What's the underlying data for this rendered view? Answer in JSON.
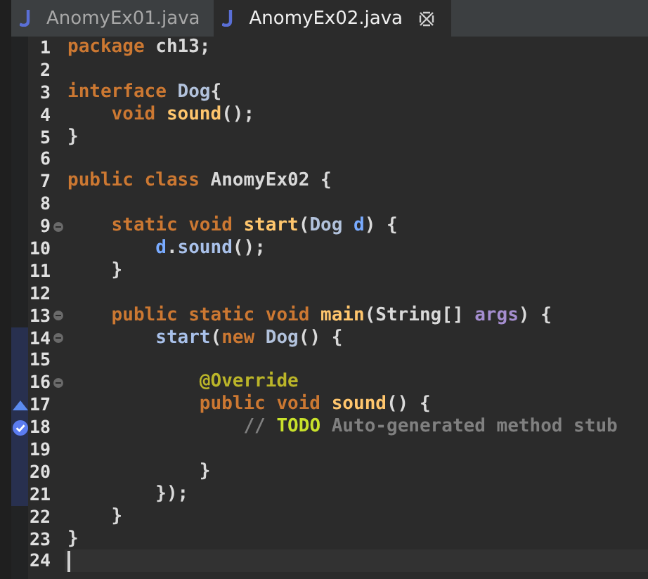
{
  "tabs": [
    {
      "label": "AnomyEx01.java",
      "selected": false
    },
    {
      "label": "AnomyEx02.java",
      "selected": true
    }
  ],
  "lines": [
    {
      "number": "1",
      "kind": "code",
      "fold": false,
      "range": false,
      "current": false,
      "tokens": [
        {
          "kind": "keyword",
          "text": "package "
        },
        {
          "kind": "plain",
          "text": "ch13;"
        }
      ]
    },
    {
      "number": "2",
      "kind": "code",
      "fold": false,
      "range": false,
      "current": false
    },
    {
      "number": "3",
      "kind": "code",
      "fold": false,
      "range": false,
      "current": false,
      "tokens": [
        {
          "kind": "keyword",
          "text": "interface "
        },
        {
          "kind": "type",
          "text": "Dog"
        },
        {
          "kind": "plain",
          "text": "{"
        }
      ]
    },
    {
      "number": "4",
      "kind": "code",
      "fold": false,
      "range": false,
      "current": false,
      "tokens": [
        {
          "kind": "keyword",
          "text": "    void "
        },
        {
          "kind": "decl",
          "text": "sound"
        },
        {
          "kind": "plain",
          "text": "();"
        }
      ]
    },
    {
      "number": "5",
      "kind": "code",
      "fold": false,
      "range": false,
      "current": false,
      "tokens": [
        {
          "kind": "plain",
          "text": "}"
        }
      ]
    },
    {
      "number": "6",
      "kind": "code",
      "fold": false,
      "range": false,
      "current": false
    },
    {
      "number": "7",
      "kind": "code",
      "fold": false,
      "range": false,
      "current": false,
      "tokens": [
        {
          "kind": "keyword",
          "text": "public class "
        },
        {
          "kind": "plain",
          "text": "AnomyEx02 {"
        }
      ]
    },
    {
      "number": "8",
      "kind": "code",
      "fold": false,
      "range": false,
      "current": false
    },
    {
      "number": "9",
      "kind": "code",
      "fold": true,
      "range": false,
      "current": false,
      "tokens": [
        {
          "kind": "keyword",
          "text": "    static void "
        },
        {
          "kind": "decl",
          "text": "start"
        },
        {
          "kind": "plain",
          "text": "("
        },
        {
          "kind": "type",
          "text": "Dog "
        },
        {
          "kind": "param",
          "text": "d"
        },
        {
          "kind": "plain",
          "text": ") {"
        }
      ]
    },
    {
      "number": "10",
      "kind": "code",
      "fold": false,
      "range": false,
      "current": false,
      "tokens": [
        {
          "kind": "param",
          "text": "        d"
        },
        {
          "kind": "plain",
          "text": "."
        },
        {
          "kind": "call",
          "text": "sound"
        },
        {
          "kind": "plain",
          "text": "();"
        }
      ]
    },
    {
      "number": "11",
      "kind": "code",
      "fold": false,
      "range": false,
      "current": false,
      "tokens": [
        {
          "kind": "plain",
          "text": "    }"
        }
      ]
    },
    {
      "number": "12",
      "kind": "code",
      "fold": false,
      "range": false,
      "current": false
    },
    {
      "number": "13",
      "kind": "code",
      "fold": true,
      "range": false,
      "current": false,
      "tokens": [
        {
          "kind": "keyword",
          "text": "    public static void "
        },
        {
          "kind": "decl",
          "text": "main"
        },
        {
          "kind": "plain",
          "text": "(String[] "
        },
        {
          "kind": "args",
          "text": "args"
        },
        {
          "kind": "plain",
          "text": ") {"
        }
      ]
    },
    {
      "number": "14",
      "kind": "code",
      "fold": true,
      "range": true,
      "current": false,
      "tokens": [
        {
          "kind": "call",
          "text": "        start"
        },
        {
          "kind": "plain",
          "text": "("
        },
        {
          "kind": "keyword",
          "text": "new "
        },
        {
          "kind": "type",
          "text": "Dog"
        },
        {
          "kind": "plain",
          "text": "() {"
        }
      ]
    },
    {
      "number": "15",
      "kind": "code",
      "fold": false,
      "range": true,
      "current": false
    },
    {
      "number": "16",
      "kind": "code",
      "fold": true,
      "range": true,
      "current": false,
      "tokens": [
        {
          "kind": "annotation",
          "text": "            @Override"
        }
      ]
    },
    {
      "number": "17",
      "kind": "override",
      "fold": false,
      "range": true,
      "current": false,
      "tokens": [
        {
          "kind": "keyword",
          "text": "            public void "
        },
        {
          "kind": "decl",
          "text": "sound"
        },
        {
          "kind": "plain",
          "text": "() {"
        }
      ]
    },
    {
      "number": "18",
      "kind": "task",
      "fold": false,
      "range": true,
      "current": false,
      "tokens": [
        {
          "kind": "comment",
          "text": "                // "
        },
        {
          "kind": "todo",
          "text": "TODO"
        },
        {
          "kind": "comment",
          "text": " Auto-generated method stub"
        }
      ]
    },
    {
      "number": "19",
      "kind": "code",
      "fold": false,
      "range": true,
      "current": false
    },
    {
      "number": "20",
      "kind": "code",
      "fold": false,
      "range": true,
      "current": false,
      "tokens": [
        {
          "kind": "plain",
          "text": "            }"
        }
      ]
    },
    {
      "number": "21",
      "kind": "code",
      "fold": false,
      "range": true,
      "current": false,
      "tokens": [
        {
          "kind": "plain",
          "text": "        });"
        }
      ]
    },
    {
      "number": "22",
      "kind": "code",
      "fold": false,
      "range": false,
      "current": false,
      "tokens": [
        {
          "kind": "plain",
          "text": "    }"
        }
      ]
    },
    {
      "number": "23",
      "kind": "code",
      "fold": false,
      "range": false,
      "current": false,
      "tokens": [
        {
          "kind": "plain",
          "text": "}"
        }
      ]
    },
    {
      "number": "24",
      "kind": "code",
      "fold": false,
      "range": false,
      "current": true
    }
  ]
}
